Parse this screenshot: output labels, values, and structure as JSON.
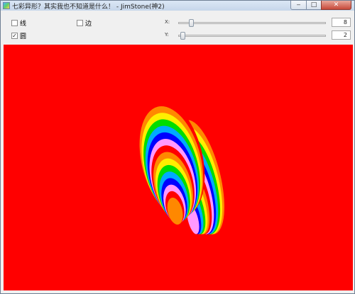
{
  "window": {
    "title": "七彩异形？其实我也不知道是什么！ - JimStone(神2)",
    "min_label": "‒",
    "max_label": "□",
    "close_label": "✕"
  },
  "controls": {
    "check_line": {
      "label": "线",
      "checked": false
    },
    "check_edge": {
      "label": "边",
      "checked": false
    },
    "check_circle": {
      "label": "圆",
      "checked": true
    },
    "check_mark": "✓",
    "x_label": "X:",
    "y_label": "Y:",
    "x_value": "8",
    "y_value": "2"
  },
  "canvas": {
    "background": "#ff0000",
    "rainbow": [
      "#ff0000",
      "#ff8800",
      "#ffee00",
      "#00dd00",
      "#00aaff",
      "#0000ff",
      "#ff99ff"
    ]
  }
}
